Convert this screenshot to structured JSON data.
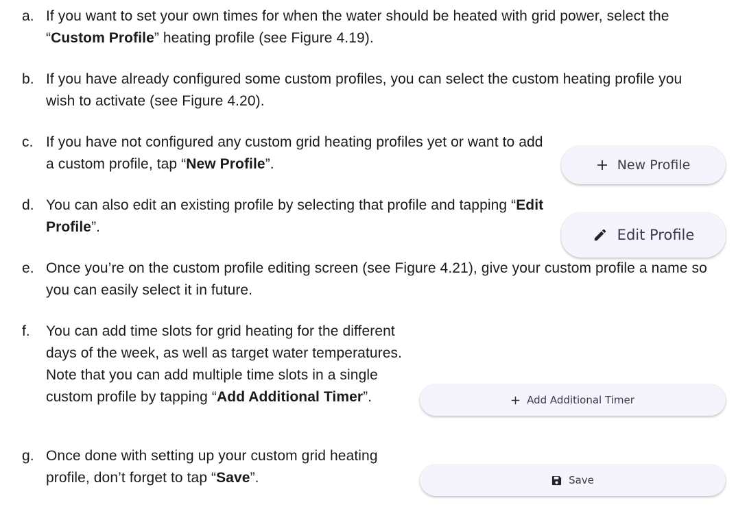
{
  "items": [
    {
      "letter": "a.",
      "parts": [
        {
          "t": "If you want to set your own times for when the water should be heated with grid power, select the “"
        },
        {
          "t": "Custom Profile",
          "b": true
        },
        {
          "t": "” heating profile (see Figure 4.19)."
        }
      ]
    },
    {
      "letter": "b.",
      "parts": [
        {
          "t": "If you have already configured some custom profiles, you can select the custom heating profile you wish to activate (see Figure 4.20)."
        }
      ]
    },
    {
      "letter": "c.",
      "parts": [
        {
          "t": "If you have not configured any custom grid heating profiles yet or want to add a custom profile, tap “"
        },
        {
          "t": "New Profile",
          "b": true
        },
        {
          "t": "”."
        }
      ]
    },
    {
      "letter": "d.",
      "parts": [
        {
          "t": "You can also edit an existing profile by selecting that profile and tapping “"
        },
        {
          "t": "Edit Profile",
          "b": true
        },
        {
          "t": "”."
        }
      ]
    },
    {
      "letter": "e.",
      "parts": [
        {
          "t": "Once you’re on the custom profile editing screen (see Figure 4.21), give your custom profile a name so you can easily select it in future."
        }
      ]
    },
    {
      "letter": "f.",
      "parts": [
        {
          "t": "You can add time slots for grid heating for the different days of the week, as well as target water temperatures. Note that you can add multiple time slots in a single custom profile by tapping “"
        },
        {
          "t": "Add Additional Timer",
          "b": true
        },
        {
          "t": "”."
        }
      ]
    },
    {
      "letter": "g.",
      "parts": [
        {
          "t": "Once done with setting up your custom grid heating profile, don’t forget to tap “"
        },
        {
          "t": "Save",
          "b": true
        },
        {
          "t": "”."
        }
      ]
    }
  ],
  "buttons": {
    "new_profile": {
      "label": "New Profile",
      "icon": "plus-icon"
    },
    "edit_profile": {
      "label": "Edit Profile",
      "icon": "pencil-icon"
    },
    "add_timer": {
      "label": "Add Additional Timer",
      "icon": "plus-icon"
    },
    "save": {
      "label": "Save",
      "icon": "floppy-disk-icon"
    }
  },
  "colors": {
    "text": "#1a1a1a",
    "button_bg": "#f5f3fb",
    "button_text": "#3a3a4e"
  }
}
